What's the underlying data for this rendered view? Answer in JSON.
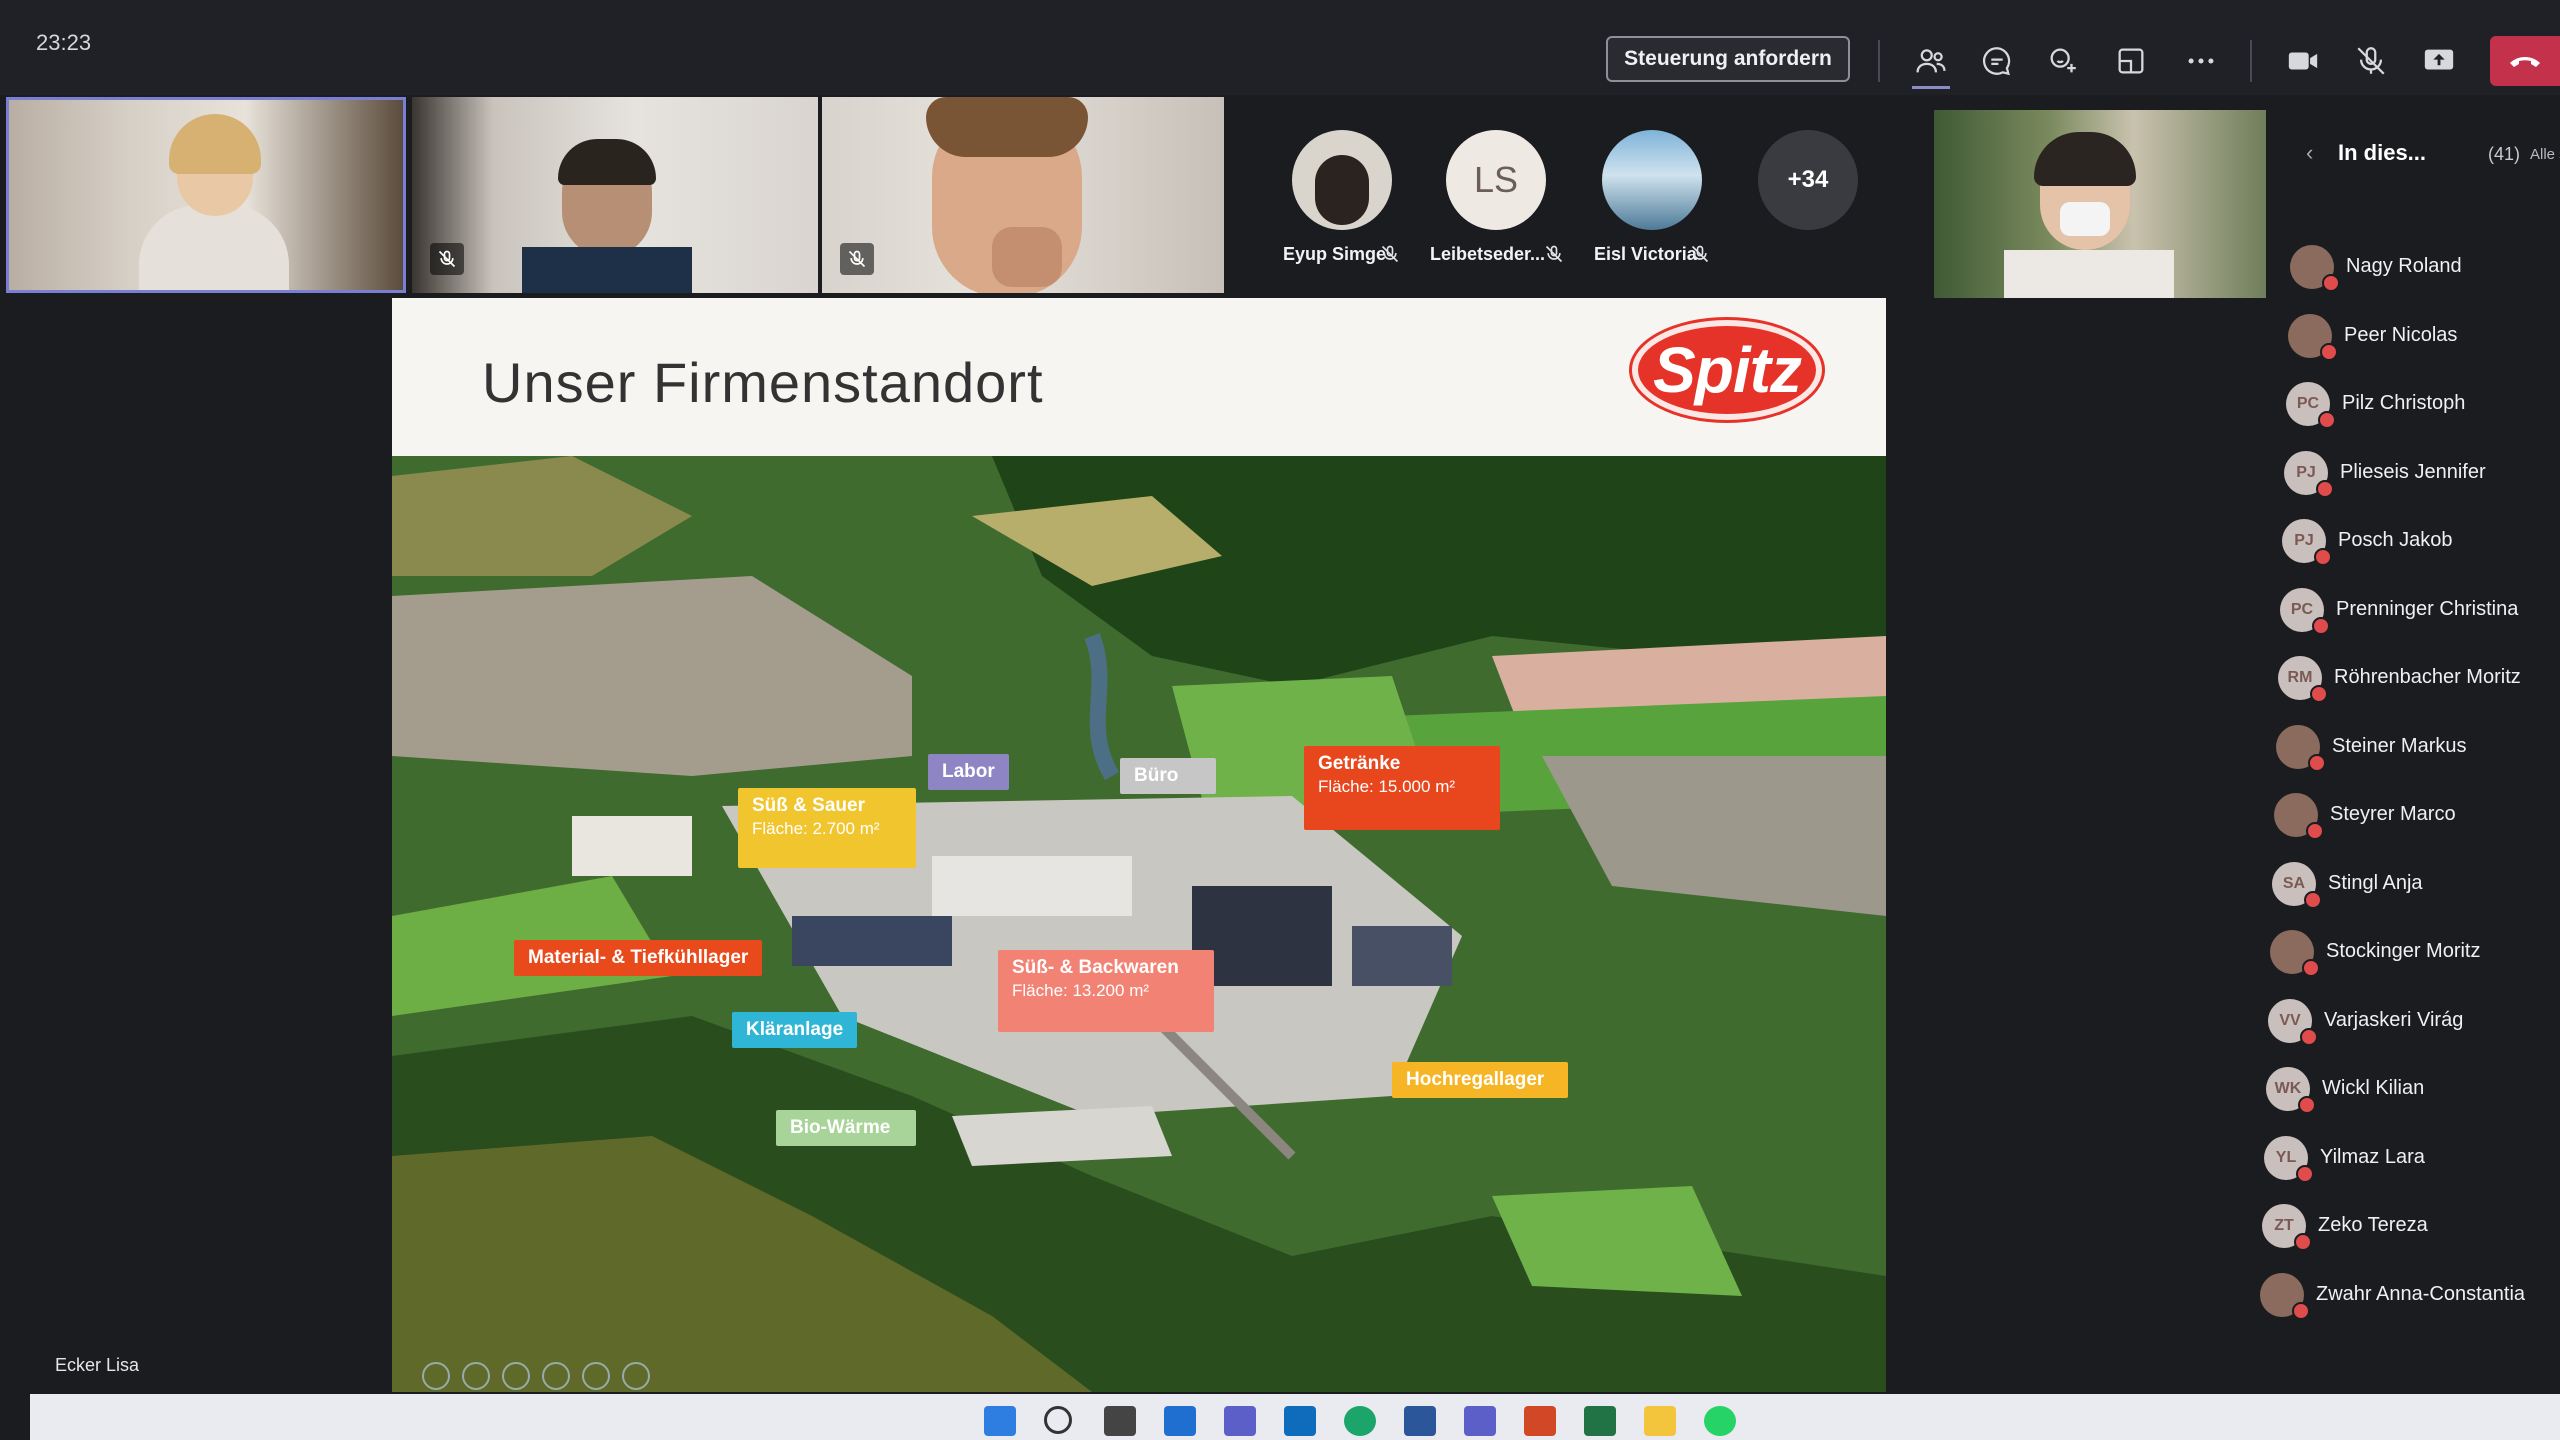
{
  "clock": "23:23",
  "toolbar": {
    "control_label": "Steuerung anfordern",
    "colors": {
      "leave": "#c4314b",
      "accent": "#6264a7"
    }
  },
  "avatars": [
    {
      "name": "Eyup Simge",
      "initials": ""
    },
    {
      "name": "Leibetseder...",
      "initials": "LS"
    },
    {
      "name": "Eisl Victoria",
      "initials": ""
    },
    {
      "name": "",
      "initials": "+34"
    }
  ],
  "slide": {
    "title": "Unser Firmenstandort",
    "logo": "Spitz",
    "labels": [
      {
        "name": "Labor"
      },
      {
        "name": "Büro"
      },
      {
        "name": "Getränke",
        "area": "Fläche: 15.000 m²"
      },
      {
        "name": "Süß & Sauer",
        "area": "Fläche: 2.700 m²"
      },
      {
        "name": "Material- & Tiefkühllager"
      },
      {
        "name": "Süß- & Backwaren",
        "area": "Fläche: 13.200 m²"
      },
      {
        "name": "Kläranlage"
      },
      {
        "name": "Hochregallager"
      },
      {
        "name": "Bio-Wärme"
      }
    ]
  },
  "presenter": "Ecker Lisa",
  "roster": {
    "heading": "In dies...",
    "count": "(41)",
    "mute_all": "Alle stumm",
    "people": [
      {
        "name": "Nagy Roland",
        "initials": ""
      },
      {
        "name": "Peer Nicolas",
        "initials": ""
      },
      {
        "name": "Pilz Christoph",
        "initials": "PC"
      },
      {
        "name": "Plieseis Jennifer",
        "initials": "PJ"
      },
      {
        "name": "Posch Jakob",
        "initials": "PJ"
      },
      {
        "name": "Prenninger Christina",
        "initials": "PC"
      },
      {
        "name": "Röhrenbacher Moritz",
        "initials": "RM"
      },
      {
        "name": "Steiner Markus",
        "initials": ""
      },
      {
        "name": "Steyrer Marco",
        "initials": ""
      },
      {
        "name": "Stingl Anja",
        "initials": "SA"
      },
      {
        "name": "Stockinger Moritz",
        "initials": ""
      },
      {
        "name": "Varjaskeri Virág",
        "initials": "VV"
      },
      {
        "name": "Wickl Kilian",
        "initials": "WK"
      },
      {
        "name": "Yilmaz Lara",
        "initials": "YL"
      },
      {
        "name": "Zeko Tereza",
        "initials": "ZT"
      },
      {
        "name": "Zwahr Anna-Constantia",
        "initials": ""
      }
    ]
  }
}
